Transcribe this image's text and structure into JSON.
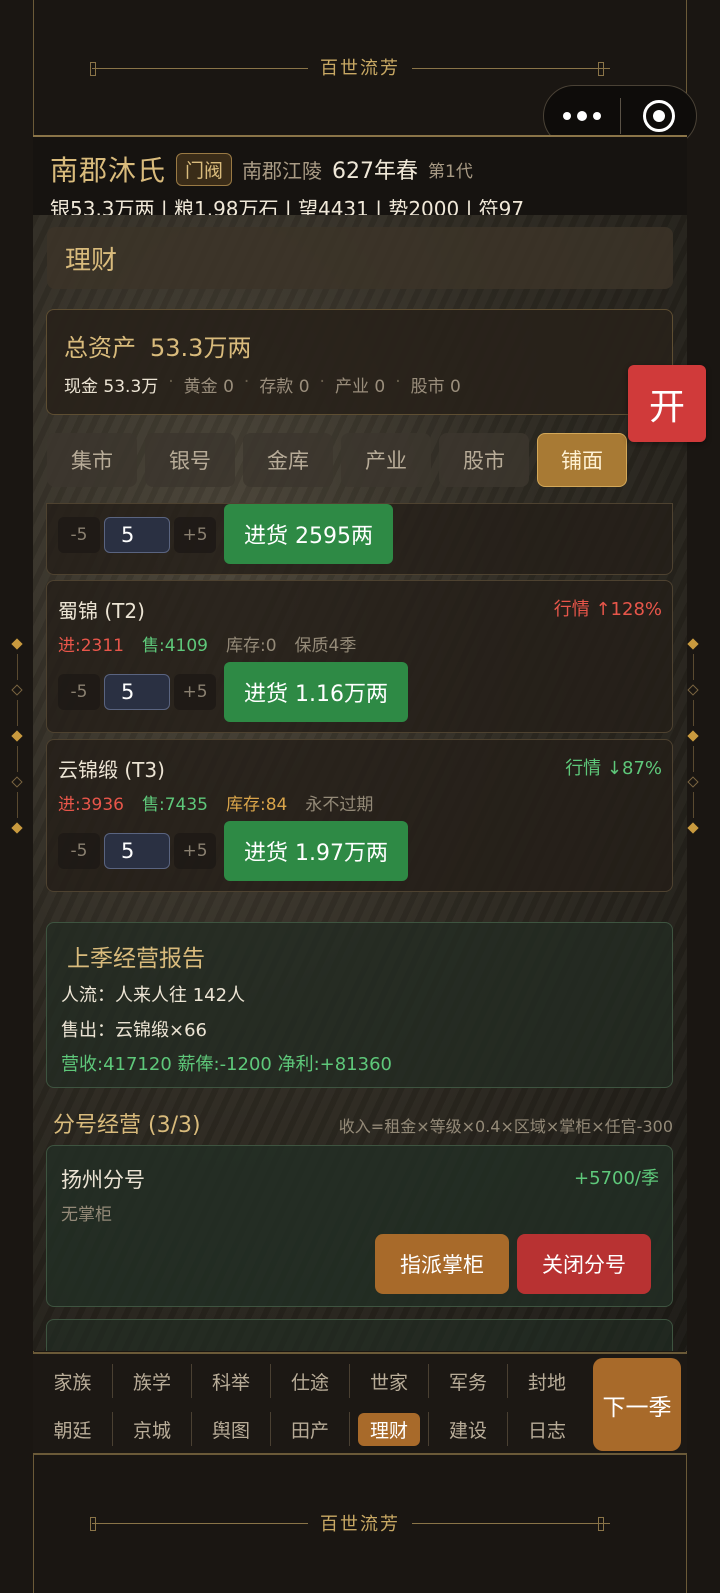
{
  "banner": {
    "title": "百世流芳"
  },
  "header": {
    "family": "南郡沐氏",
    "rank": "门阀",
    "place": "南郡江陵",
    "season": "627年春",
    "generation": "第1代",
    "resources": "银53.3万两 | 粮1.98万石 | 望4431 | 势2000 | 符97"
  },
  "section": {
    "title": "理财"
  },
  "assets": {
    "label": "总资产",
    "total": "53.3万两",
    "breakdown": [
      "现金 53.3万",
      "黄金 0",
      "存款 0",
      "产业 0",
      "股市 0"
    ]
  },
  "tabs": [
    "集市",
    "银号",
    "金库",
    "产业",
    "股市",
    "铺面"
  ],
  "active_tab": "铺面",
  "open_button": "开",
  "partial_item": {
    "minus": "-5",
    "qty": "5",
    "plus": "+5",
    "buy": "进货 2595两"
  },
  "items": [
    {
      "name": "蜀锦 (T2)",
      "trend": "行情 ↑128%",
      "buy_price": "进:2311",
      "sell_price": "售:4109",
      "stock": "库存:0",
      "shelf": "保质4季",
      "minus": "-5",
      "qty": "5",
      "plus": "+5",
      "buy": "进货 1.16万两"
    },
    {
      "name": "云锦缎 (T3)",
      "trend": "行情 ↓87%",
      "buy_price": "进:3936",
      "sell_price": "售:7435",
      "stock": "库存:84",
      "shelf": "永不过期",
      "minus": "-5",
      "qty": "5",
      "plus": "+5",
      "buy": "进货 1.97万两"
    }
  ],
  "report": {
    "title": "上季经营报告",
    "traffic": "人流：人来人往 142人",
    "sold": "售出：云锦缎×66",
    "summary": "营收:417120 薪俸:-1200 净利:+81360"
  },
  "branches": {
    "title": "分号经营 (3/3)",
    "formula": "收入=租金×等级×0.4×区域×掌柜×任官-300",
    "items": [
      {
        "name": "扬州分号",
        "income": "+5700/季",
        "manager": "无掌柜",
        "assign": "指派掌柜",
        "close": "关闭分号"
      }
    ]
  },
  "nav": {
    "row1": [
      "家族",
      "族学",
      "科举",
      "仕途",
      "世家",
      "军务",
      "封地"
    ],
    "row2": [
      "朝廷",
      "京城",
      "舆图",
      "田产",
      "理财",
      "建设",
      "日志"
    ],
    "active": "理财",
    "next": "下一季"
  },
  "colors": {
    "accent_gold": "#d9bb7c",
    "buy_green": "#2e8a45",
    "trend_up_red": "#e8564a",
    "trend_down_green": "#5ec87a",
    "danger_red": "#b83232",
    "active_tab": "#a87a34"
  }
}
